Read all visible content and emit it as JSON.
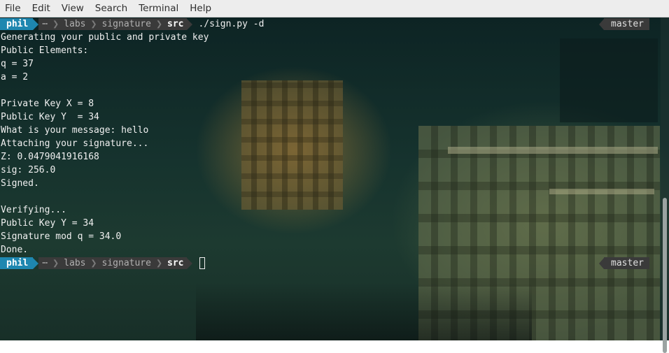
{
  "menu": [
    "File",
    "Edit",
    "View",
    "Search",
    "Terminal",
    "Help"
  ],
  "prompt1": {
    "user": "phil",
    "ellipsis": "⋯",
    "dirs": [
      "labs",
      "signature"
    ],
    "current": "src",
    "command": "./sign.py -d",
    "branch_icon": "",
    "branch": "master"
  },
  "output": [
    "Generating your public and private key",
    "Public Elements:",
    "q = 37",
    "a = 2",
    "",
    "Private Key X = 8",
    "Public Key Y  = 34",
    "What is your message: hello",
    "Attaching your signature...",
    "Z: 0.0479041916168",
    "sig: 256.0",
    "Signed.",
    "",
    "Verifying...",
    "Public Key Y = 34",
    "Signature mod q = 34.0",
    "Done."
  ],
  "prompt2": {
    "user": "phil",
    "ellipsis": "⋯",
    "dirs": [
      "labs",
      "signature"
    ],
    "current": "src",
    "command": "",
    "branch_icon": "",
    "branch": "master"
  },
  "colors": {
    "prompt_user_bg": "#1e87b0",
    "prompt_dir_bg": "#3a3a3a",
    "text": "#f0f0f0",
    "menubar_bg": "#ededed"
  }
}
